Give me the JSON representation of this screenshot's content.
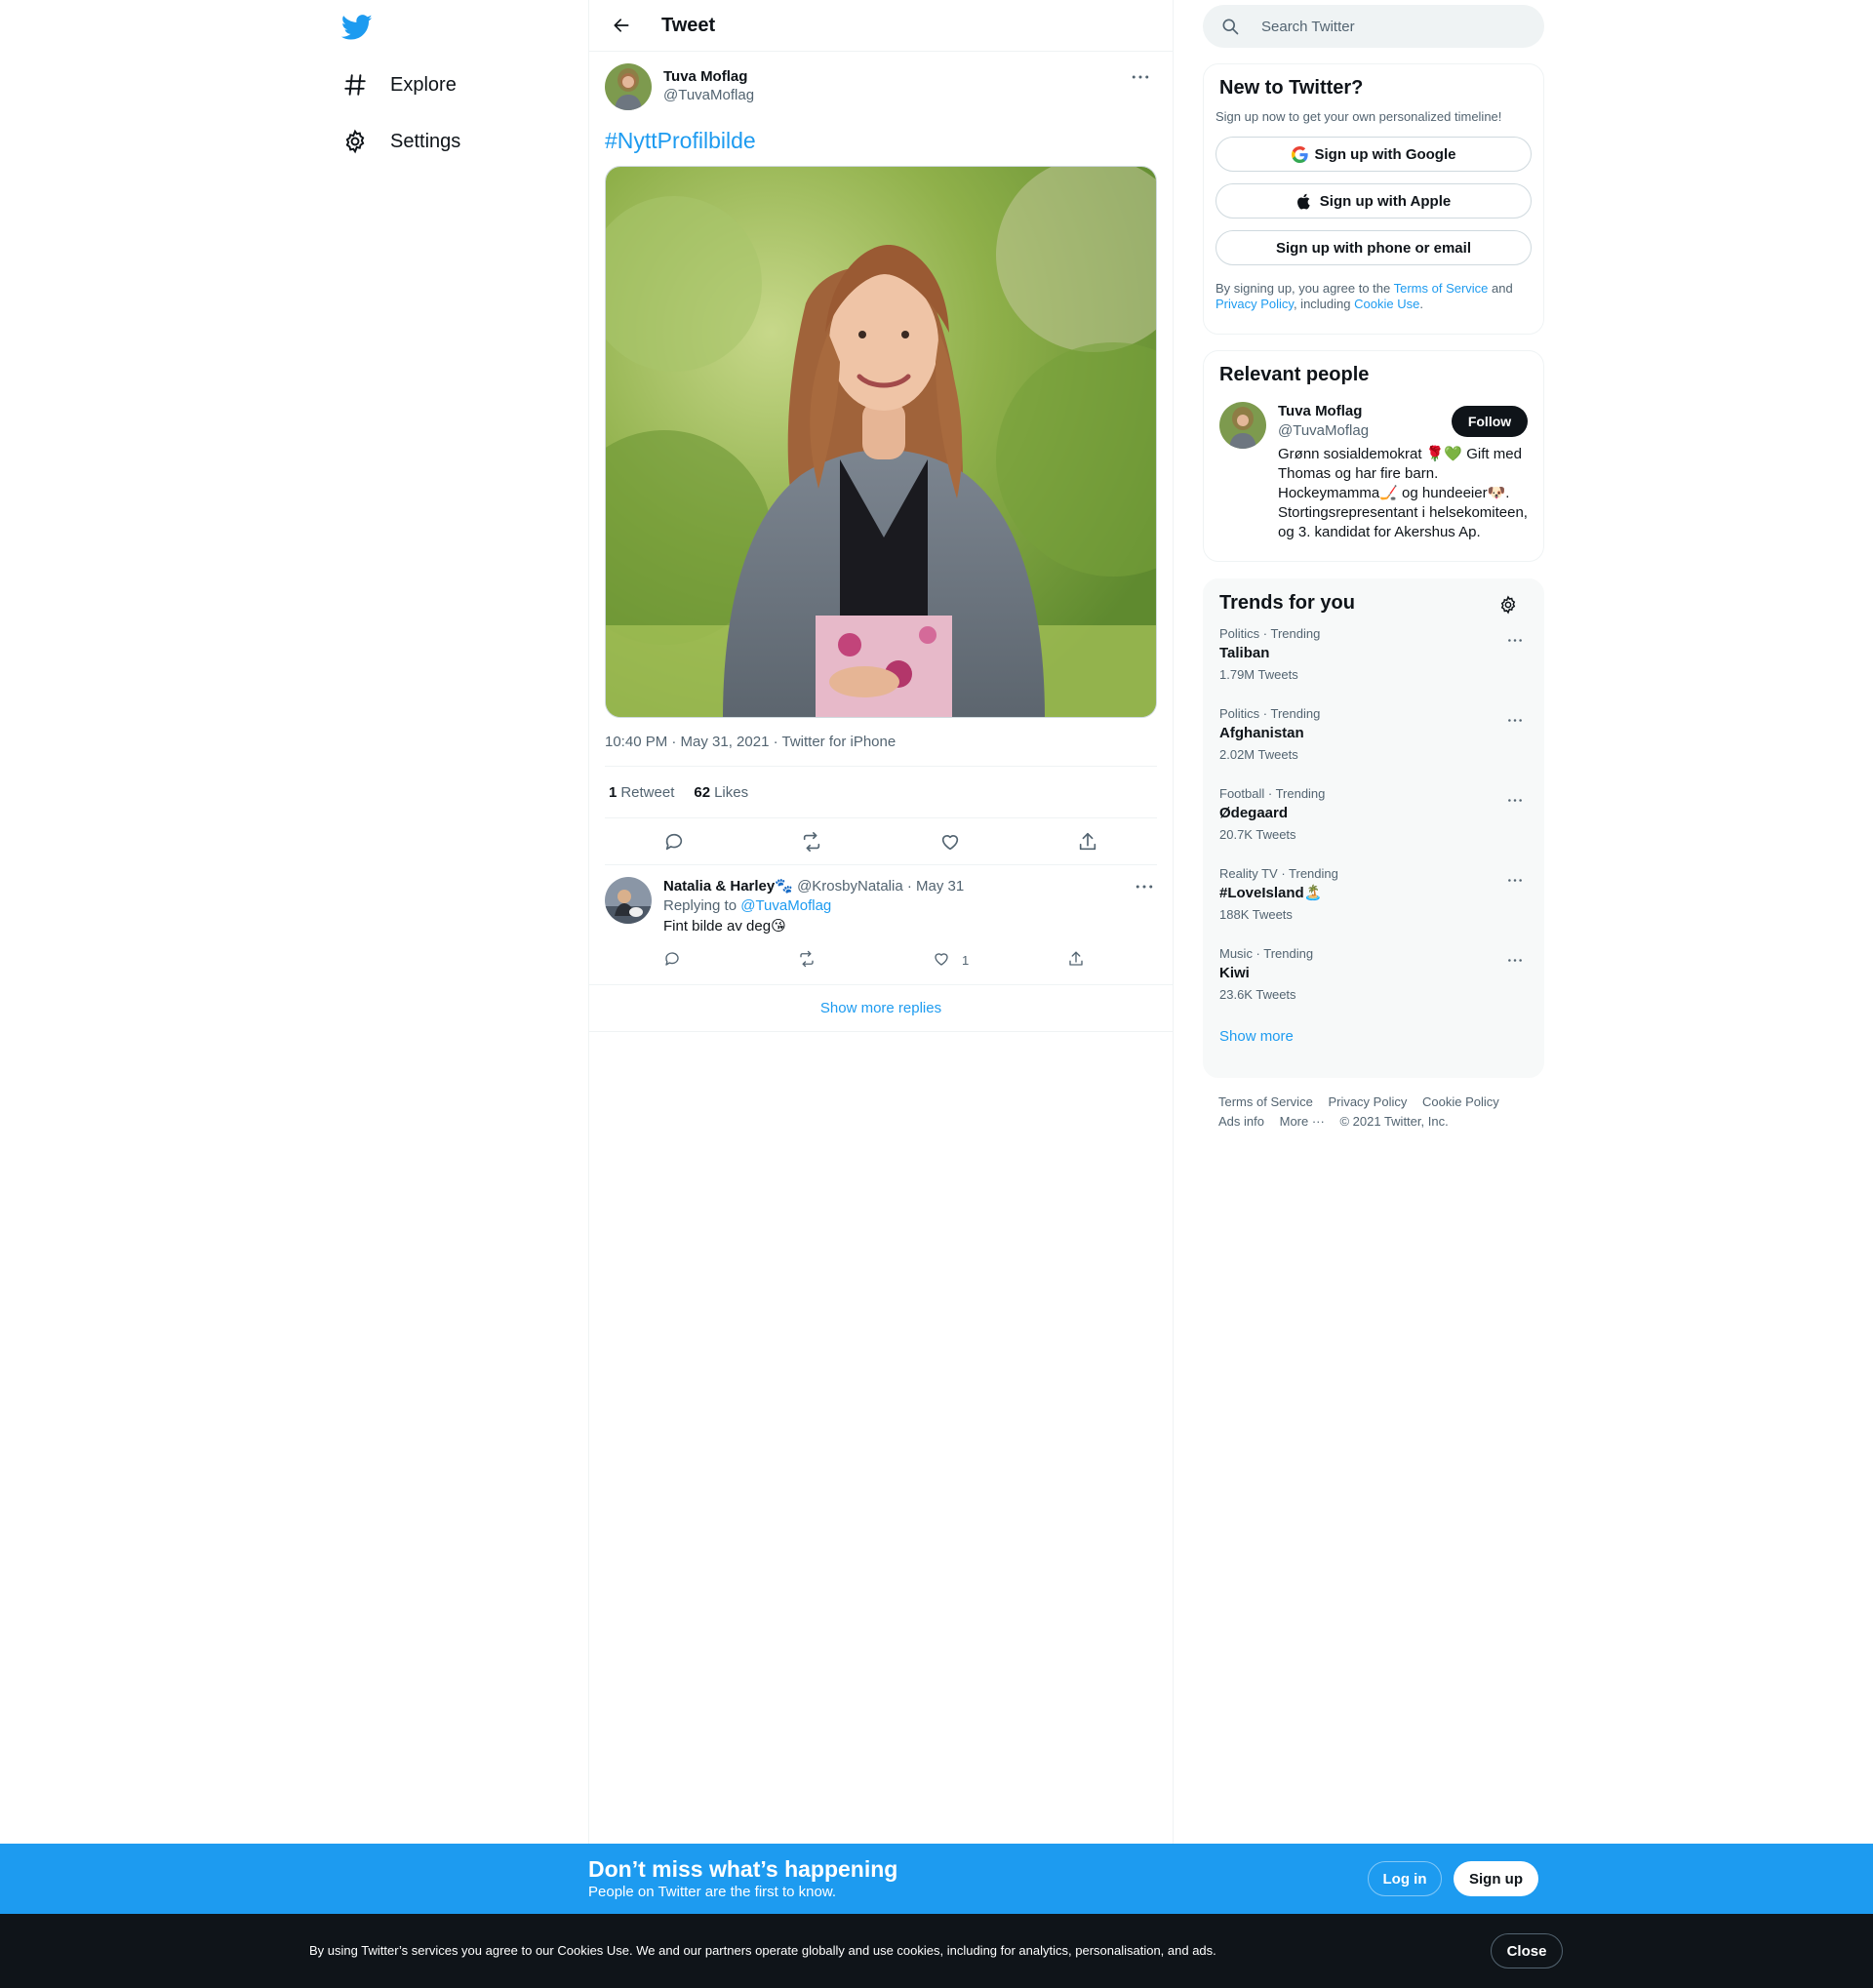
{
  "nav": {
    "logo": "twitter-bird-icon",
    "items": [
      {
        "label": "Explore",
        "icon": "hashtag-icon"
      },
      {
        "label": "Settings",
        "icon": "gear-icon"
      }
    ]
  },
  "header": {
    "title": "Tweet"
  },
  "tweet": {
    "author_name": "Tuva Moflag",
    "author_handle": "@TuvaMoflag",
    "text": "#NyttProfilbilde",
    "meta": "10:40 PM · May 31, 2021 · Twitter for iPhone",
    "retweets_count": "1",
    "retweets_label": "Retweet",
    "likes_count": "62",
    "likes_label": "Likes"
  },
  "reply": {
    "name": "Natalia & Harley🐾",
    "handle_date": "@KrosbyNatalia · May 31",
    "replying_prefix": "Replying to",
    "replying_to": "@TuvaMoflag",
    "text": "Fint bilde av deg😘",
    "like_count": "1"
  },
  "show_more_replies": "Show more replies",
  "search": {
    "placeholder": "Search Twitter"
  },
  "signup_card": {
    "title": "New to Twitter?",
    "subtitle": "Sign up now to get your own personalized timeline!",
    "google": "Sign up with Google",
    "apple": "Sign up with Apple",
    "phone": "Sign up with phone or email",
    "legal_1": "By signing up, you agree to the ",
    "terms": "Terms of Service",
    "legal_2": " and ",
    "privacy": "Privacy Policy",
    "legal_3": ", including ",
    "cookie": "Cookie Use",
    "legal_4": "."
  },
  "relevant": {
    "title": "Relevant people",
    "name": "Tuva Moflag",
    "handle": "@TuvaMoflag",
    "follow": "Follow",
    "bio": "Grønn sosialdemokrat 🌹💚 Gift med Thomas og har fire barn. Hockeymamma🏒 og hundeeier🐶. Stortingsrepresentant i helsekomiteen, og 3. kandidat for Akershus Ap."
  },
  "trends": {
    "title": "Trends for you",
    "items": [
      {
        "category": "Politics · Trending",
        "name": "Taliban",
        "count": "1.79M Tweets"
      },
      {
        "category": "Politics · Trending",
        "name": "Afghanistan",
        "count": "2.02M Tweets"
      },
      {
        "category": "Football · Trending",
        "name": "Ødegaard",
        "count": "20.7K Tweets"
      },
      {
        "category": "Reality TV · Trending",
        "name": "#LoveIsland🏝️",
        "count": "188K Tweets"
      },
      {
        "category": "Music · Trending",
        "name": "Kiwi",
        "count": "23.6K Tweets"
      }
    ],
    "show_more": "Show more"
  },
  "footer": {
    "terms": "Terms of Service",
    "privacy": "Privacy Policy",
    "cookie": "Cookie Policy",
    "ads": "Ads info",
    "more": "More ···",
    "copyright": "© 2021 Twitter, Inc."
  },
  "banner": {
    "title": "Don’t miss what’s happening",
    "subtitle": "People on Twitter are the first to know.",
    "login": "Log in",
    "signup": "Sign up"
  },
  "cookies": {
    "text": "By using Twitter’s services you agree to our Cookies Use. We and our partners operate globally and use cookies, including for analytics, personalisation, and ads.",
    "close": "Close"
  },
  "colors": {
    "accent": "#1d9bf0",
    "text": "#0f1419",
    "muted": "#536471",
    "border": "#eff3f4"
  }
}
